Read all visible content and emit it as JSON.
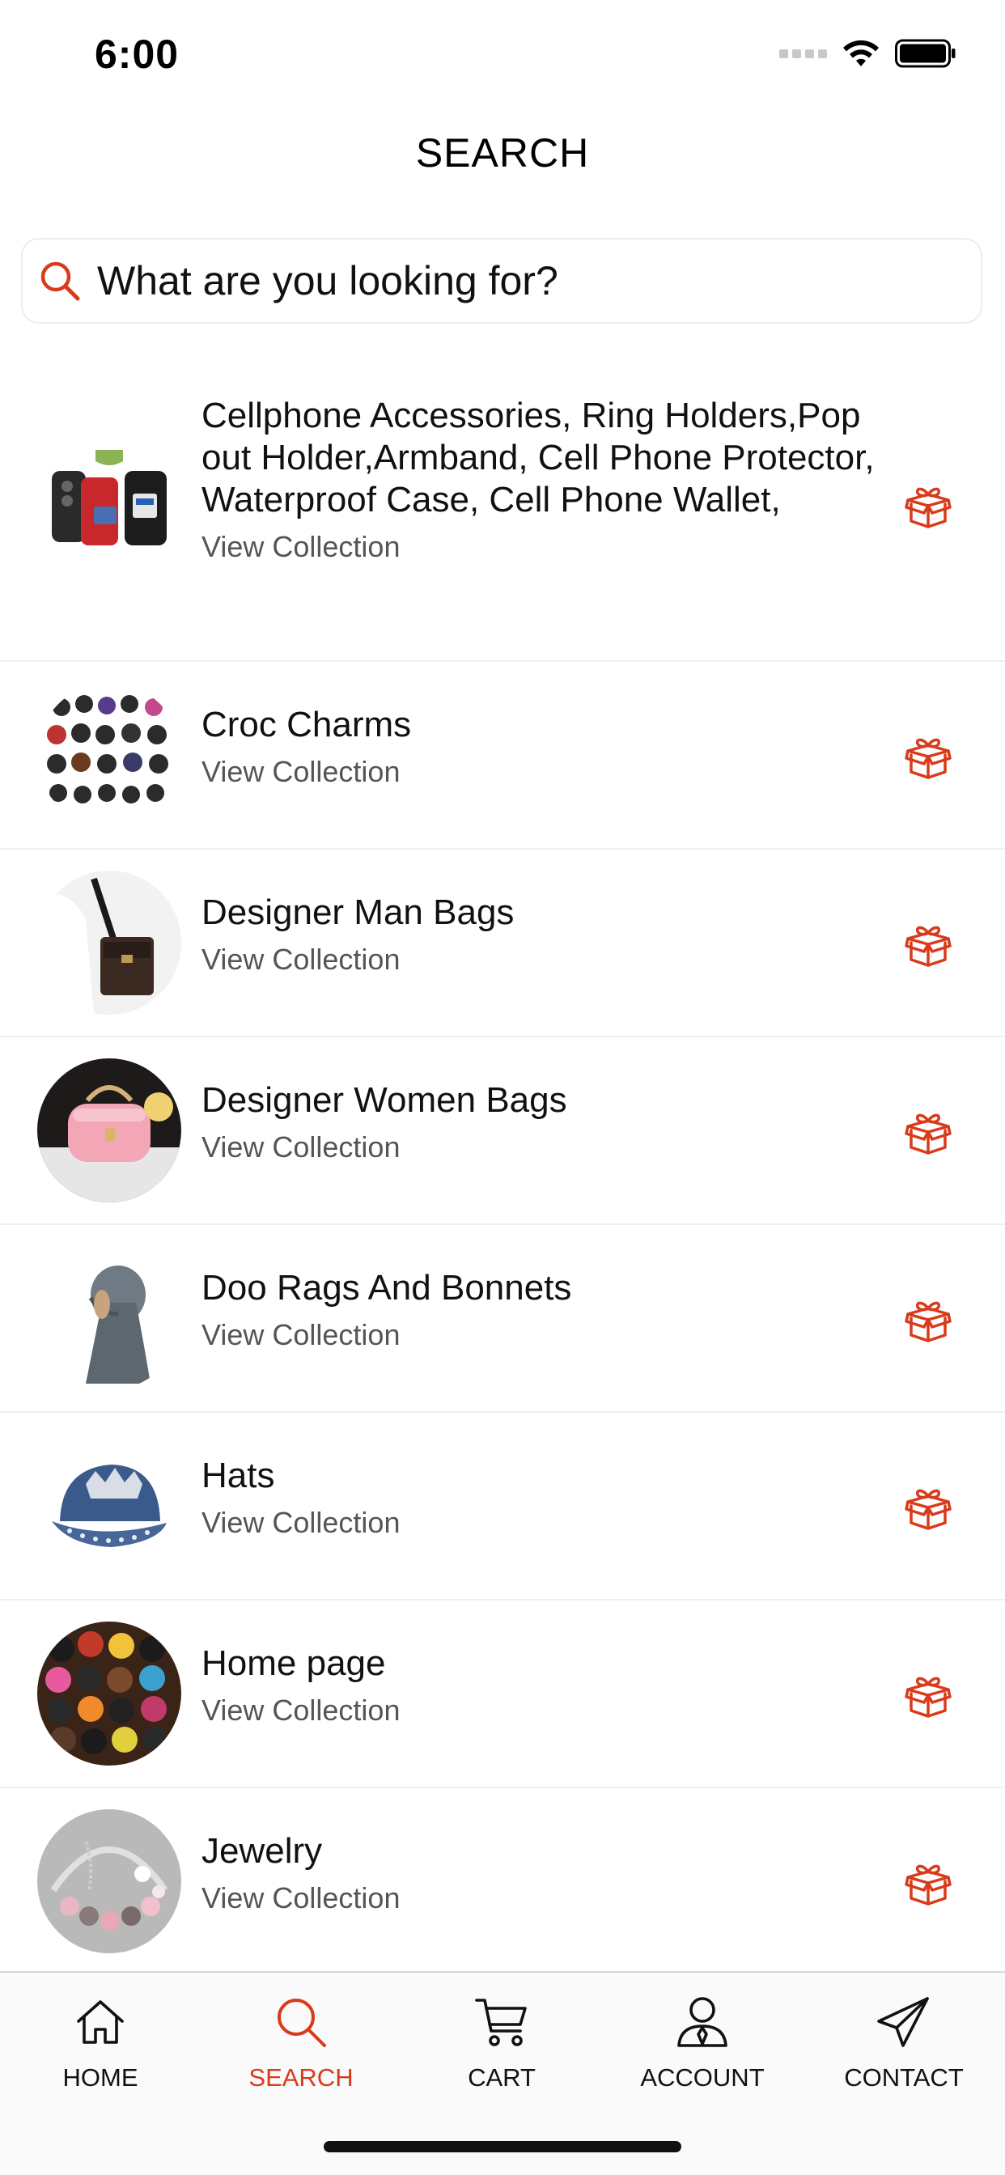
{
  "status_bar": {
    "time": "6:00"
  },
  "header": {
    "title": "SEARCH"
  },
  "search": {
    "placeholder": "What are you looking for?"
  },
  "colors": {
    "accent": "#d93a1a",
    "text": "#111111",
    "subtext": "#555555",
    "divider": "#efefef"
  },
  "collections": [
    {
      "title": "Cellphone Accessories, Ring Holders,Pop out Holder,Armband, Cell Phone Protector, Waterproof Case, Cell Phone Wallet,",
      "link": "View Collection",
      "icon": "gift-box-icon"
    },
    {
      "title": "Croc Charms",
      "link": "View Collection",
      "icon": "gift-box-icon"
    },
    {
      "title": "Designer Man Bags",
      "link": "View Collection",
      "icon": "gift-box-icon"
    },
    {
      "title": "Designer Women Bags",
      "link": "View Collection",
      "icon": "gift-box-icon"
    },
    {
      "title": "Doo Rags And Bonnets",
      "link": "View Collection",
      "icon": "gift-box-icon"
    },
    {
      "title": "Hats",
      "link": "View Collection",
      "icon": "gift-box-icon"
    },
    {
      "title": "Home page",
      "link": "View Collection",
      "icon": "gift-box-icon"
    },
    {
      "title": "Jewelry",
      "link": "View Collection",
      "icon": "gift-box-icon"
    }
  ],
  "tabs": [
    {
      "label": "HOME",
      "icon": "home-icon",
      "active": false
    },
    {
      "label": "SEARCH",
      "icon": "search-icon",
      "active": true
    },
    {
      "label": "CART",
      "icon": "cart-icon",
      "active": false
    },
    {
      "label": "ACCOUNT",
      "icon": "account-icon",
      "active": false
    },
    {
      "label": "CONTACT",
      "icon": "send-icon",
      "active": false
    }
  ]
}
